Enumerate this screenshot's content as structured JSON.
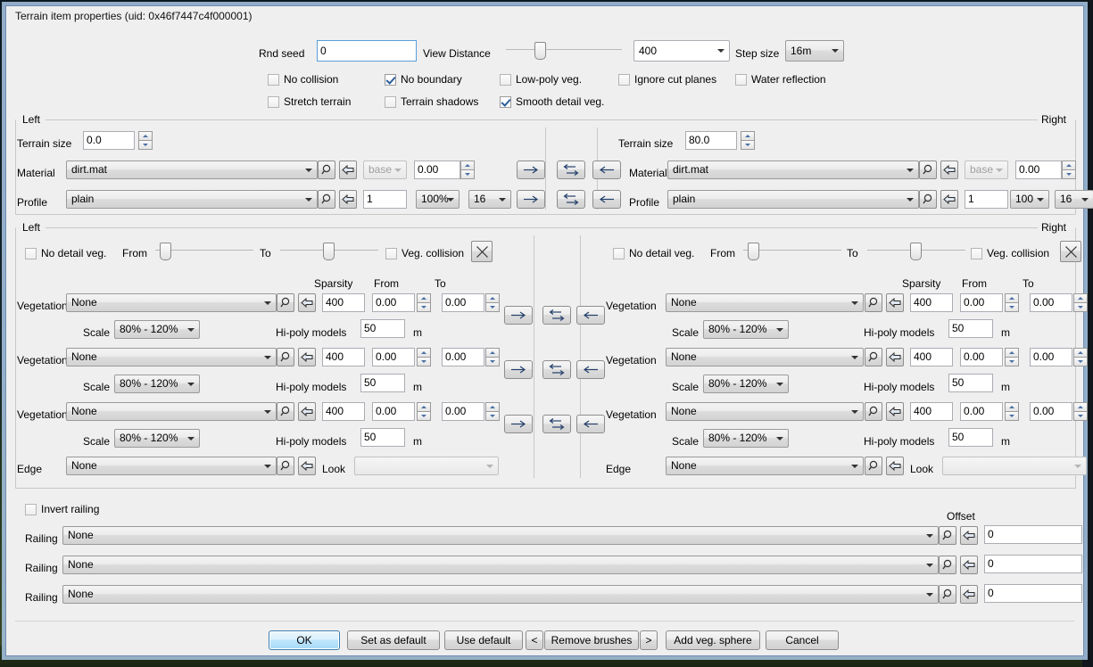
{
  "window": {
    "title": "Terrain item properties (uid: 0x46f7447c4f000001)"
  },
  "top": {
    "rnd_seed_label": "Rnd seed",
    "rnd_seed_value": "0",
    "view_distance_label": "View Distance",
    "view_distance_value": "400",
    "step_size_label": "Step size",
    "step_size_value": "16m",
    "checkboxes": [
      {
        "label": "No collision",
        "checked": false
      },
      {
        "label": "No boundary",
        "checked": true
      },
      {
        "label": "Low-poly veg.",
        "checked": false
      },
      {
        "label": "Ignore cut planes",
        "checked": false
      },
      {
        "label": "Water reflection",
        "checked": false
      },
      {
        "label": "Stretch terrain",
        "checked": false
      },
      {
        "label": "Terrain shadows",
        "checked": false
      },
      {
        "label": "Smooth detail veg.",
        "checked": true
      }
    ]
  },
  "terrain_group": {
    "left_title": "Left",
    "right_title": "Right",
    "terrain_size_label": "Terrain size",
    "material_label": "Material",
    "profile_label": "Profile",
    "left": {
      "terrain_size": "0.0",
      "material": "dirt.mat",
      "material_base": "base",
      "material_value": "0.00",
      "profile": "plain",
      "profile_count": "1",
      "profile_percent": "100%",
      "profile_steps": "16"
    },
    "right": {
      "terrain_size": "80.0",
      "material": "dirt.mat",
      "material_base": "base",
      "material_value": "0.00",
      "profile": "plain",
      "profile_count": "1",
      "profile_percent": "100",
      "profile_steps": "16"
    }
  },
  "veg_group": {
    "left_title": "Left",
    "right_title": "Right",
    "no_detail_veg_label": "No detail veg.",
    "from_label": "From",
    "to_label": "To",
    "veg_collision_label": "Veg. collision",
    "sparsity_header": "Sparsity",
    "from_header": "From",
    "to_header": "To",
    "vegetation_label": "Vegetation",
    "scale_label": "Scale",
    "hipoly_label": "Hi-poly models",
    "meters_unit": "m",
    "edge_label": "Edge",
    "look_label": "Look",
    "left": {
      "no_detail_veg": false,
      "veg_collision": false,
      "rows": [
        {
          "vegetation": "None",
          "sparsity": "400",
          "from": "0.00",
          "to": "0.00",
          "scale": "80% - 120%",
          "hipoly": "50"
        },
        {
          "vegetation": "None",
          "sparsity": "400",
          "from": "0.00",
          "to": "0.00",
          "scale": "80% - 120%",
          "hipoly": "50"
        },
        {
          "vegetation": "None",
          "sparsity": "400",
          "from": "0.00",
          "to": "0.00",
          "scale": "80% - 120%",
          "hipoly": "50"
        }
      ],
      "edge": "None",
      "look": ""
    },
    "right": {
      "no_detail_veg": false,
      "veg_collision": false,
      "rows": [
        {
          "vegetation": "None",
          "sparsity": "400",
          "from": "0.00",
          "to": "0.00",
          "scale": "80% - 120%",
          "hipoly": "50"
        },
        {
          "vegetation": "None",
          "sparsity": "400",
          "from": "0.00",
          "to": "0.00",
          "scale": "80% - 120%",
          "hipoly": "50"
        },
        {
          "vegetation": "None",
          "sparsity": "400",
          "from": "0.00",
          "to": "0.00",
          "scale": "80% - 120%",
          "hipoly": "50"
        }
      ],
      "edge": "None",
      "look": ""
    }
  },
  "railing": {
    "invert_label": "Invert railing",
    "invert_checked": false,
    "offset_header": "Offset",
    "railing_label": "Railing",
    "rows": [
      {
        "value": "None",
        "offset": "0"
      },
      {
        "value": "None",
        "offset": "0"
      },
      {
        "value": "None",
        "offset": "0"
      }
    ]
  },
  "buttons": {
    "ok": "OK",
    "set_as_default": "Set as default",
    "use_default": "Use default",
    "prev": "<",
    "remove_brushes": "Remove brushes",
    "next": ">",
    "add_veg_sphere": "Add veg. sphere",
    "cancel": "Cancel"
  },
  "colors": {
    "dialog_bg": "#efeff0",
    "border": "#6f8db0",
    "accent": "#3c7fb1",
    "check": "#2b5d9b"
  }
}
